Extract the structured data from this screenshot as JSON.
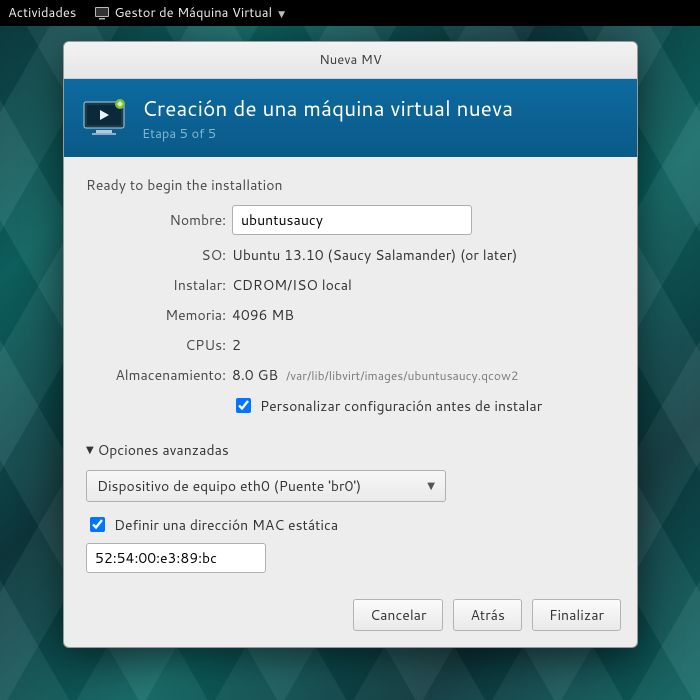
{
  "topbar": {
    "activities": "Actividades",
    "app_name": "Gestor de Máquina Virtual"
  },
  "dialog": {
    "title": "Nueva MV",
    "banner_title": "Creación de una máquina virtual nueva",
    "step_text": "Etapa 5 of 5",
    "ready_text": "Ready to begin the installation",
    "labels": {
      "name": "Nombre:",
      "os": "SO:",
      "install": "Instalar:",
      "memory": "Memoria:",
      "cpus": "CPUs:",
      "storage": "Almacenamiento:"
    },
    "values": {
      "name": "ubuntusaucy",
      "os": "Ubuntu 13.10 (Saucy Salamander) (or later)",
      "install": "CDROM/ISO local",
      "memory": "4096 MB",
      "cpus": "2",
      "storage_size": "8.0 GB",
      "storage_path": "/var/lib/libvirt/images/ubuntusaucy.qcow2"
    },
    "customize_label": "Personalizar configuración antes de instalar",
    "advanced_label": "Opciones avanzadas",
    "network_combo": "Dispositivo de equipo eth0 (Puente 'br0')",
    "mac_static_label": "Definir una dirección MAC estática",
    "mac_value": "52:54:00:e3:89:bc",
    "buttons": {
      "cancel": "Cancelar",
      "back": "Atrás",
      "finish": "Finalizar"
    }
  }
}
